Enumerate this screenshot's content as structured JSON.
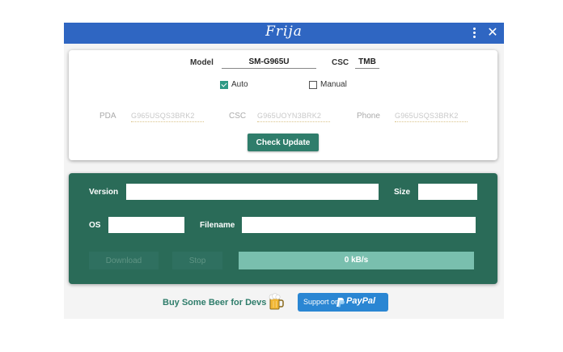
{
  "window": {
    "title": "Frija"
  },
  "check": {
    "model_label": "Model",
    "model_value": "SM-G965U",
    "csc_label": "CSC",
    "csc_value": "TMB",
    "auto_label": "Auto",
    "auto_checked": true,
    "manual_label": "Manual",
    "manual_checked": false,
    "pda_label": "PDA",
    "pda_value": "G965USQS3BRK2",
    "csc2_label": "CSC",
    "csc2_value": "G965UOYN3BRK2",
    "phone_label": "Phone",
    "phone_value": "G965USQS3BRK2",
    "button_label": "Check Update"
  },
  "download": {
    "version_label": "Version",
    "version_value": "",
    "size_label": "Size",
    "size_value": "",
    "os_label": "OS",
    "os_value": "",
    "filename_label": "Filename",
    "filename_value": "",
    "download_label": "Download",
    "stop_label": "Stop",
    "speed_text": "0 kB/s",
    "progress_fraction": 1.0
  },
  "footer": {
    "beer_text": "Buy Some Beer for Devs",
    "support_text": "Support on",
    "paypal_text": "PayPal"
  },
  "colors": {
    "titlebar": "#2f66c2",
    "accent": "#2f7d6b",
    "panel": "#2a6b58",
    "progress": "#79bfae",
    "paypal": "#2a86d3"
  }
}
